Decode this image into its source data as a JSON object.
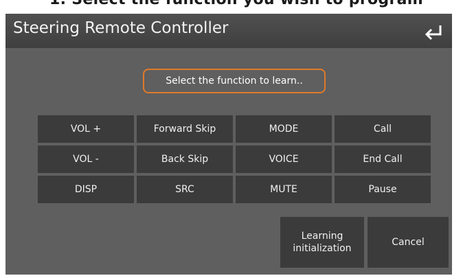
{
  "caption": "1. Select the function you wish to program",
  "header": {
    "title": "Steering Remote Controller",
    "back_icon": "back-arrow-icon"
  },
  "prompt": "Select the function to learn..",
  "functions": [
    "VOL +",
    "Forward Skip",
    "MODE",
    "Call",
    "VOL -",
    "Back Skip",
    "VOICE",
    "End Call",
    "DISP",
    "SRC",
    "MUTE",
    "Pause"
  ],
  "buttons": {
    "learning_line1": "Learning",
    "learning_line2": "initialization",
    "cancel": "Cancel"
  },
  "colors": {
    "background": "#5f5f5f",
    "button": "#3b3b3b",
    "highlight": "#e07a2a"
  }
}
